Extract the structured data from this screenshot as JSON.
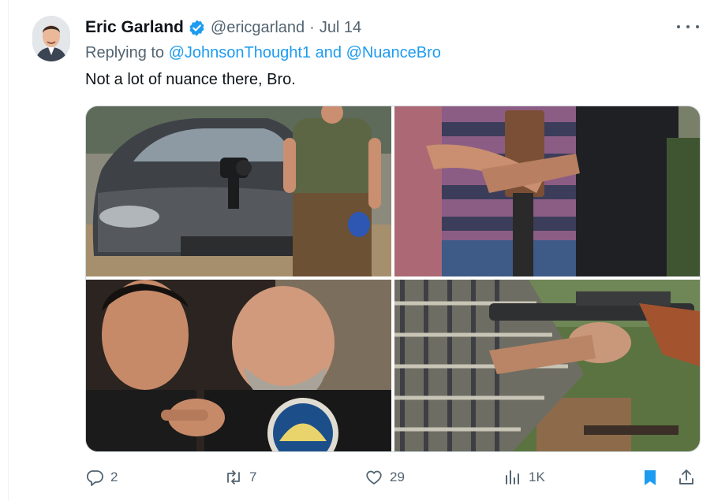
{
  "tweet": {
    "display_name": "Eric Garland",
    "handle": "@ericgarland",
    "separator": "·",
    "date": "Jul 14",
    "replying_prefix": "Replying to",
    "mention_1": "@JohnsonThought1",
    "mention_joiner": "and",
    "mention_2": "@NuanceBro",
    "text": "Not a lot of nuance there, Bro."
  },
  "media": [
    {
      "icon": "photo-man-with-tesla-mounted-gun"
    },
    {
      "icon": "photo-man-holding-rifle"
    },
    {
      "icon": "photo-two-men-pointing"
    },
    {
      "icon": "photo-person-firing-ak-rifle"
    }
  ],
  "actions": {
    "reply_count": "2",
    "retweet_count": "7",
    "like_count": "29",
    "views_count": "1K"
  },
  "colors": {
    "accent": "#1d9bf0",
    "secondary_text": "#536471",
    "primary_text": "#0f1419",
    "border": "#cfd9de"
  }
}
